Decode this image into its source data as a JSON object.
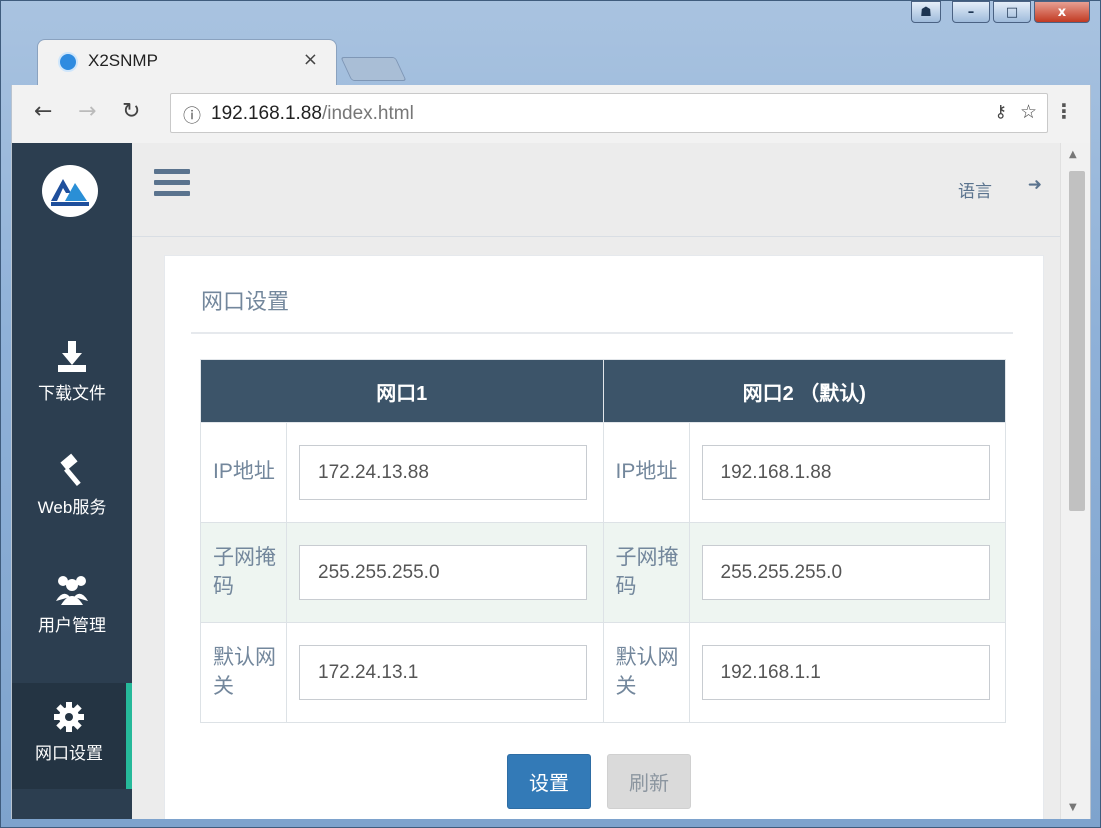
{
  "browser": {
    "tab_title": "X2SNMP",
    "tab_close": "×",
    "url_host": "192.168.1.88",
    "url_path": "/index.html",
    "window_controls": {
      "minimize": "–",
      "maximize": "□",
      "close": "x"
    }
  },
  "header": {
    "language_label": "语言"
  },
  "sidebar": {
    "items": [
      {
        "label": "下载文件",
        "icon": "download-icon"
      },
      {
        "label": "Web服务",
        "icon": "gavel-icon"
      },
      {
        "label": "用户管理",
        "icon": "users-icon"
      },
      {
        "label": "网口设置",
        "icon": "gear-icon",
        "active": true
      }
    ]
  },
  "panel": {
    "title": "网口设置",
    "columns": [
      "网口1",
      "网口2 （默认)"
    ],
    "rows": [
      {
        "label": "IP地址",
        "port1": "172.24.13.88",
        "port2": "192.168.1.88"
      },
      {
        "label": "子网掩码",
        "port1": "255.255.255.0",
        "port2": "255.255.255.0"
      },
      {
        "label": "默认网关",
        "port1": "172.24.13.1",
        "port2": "192.168.1.1"
      }
    ],
    "set_button": "设置",
    "refresh_button": "刷新"
  },
  "colors": {
    "sidebar_bg": "#2c3e50",
    "table_header_bg": "#3c5469",
    "active_accent": "#26b99a",
    "primary_button": "#337ab7"
  }
}
